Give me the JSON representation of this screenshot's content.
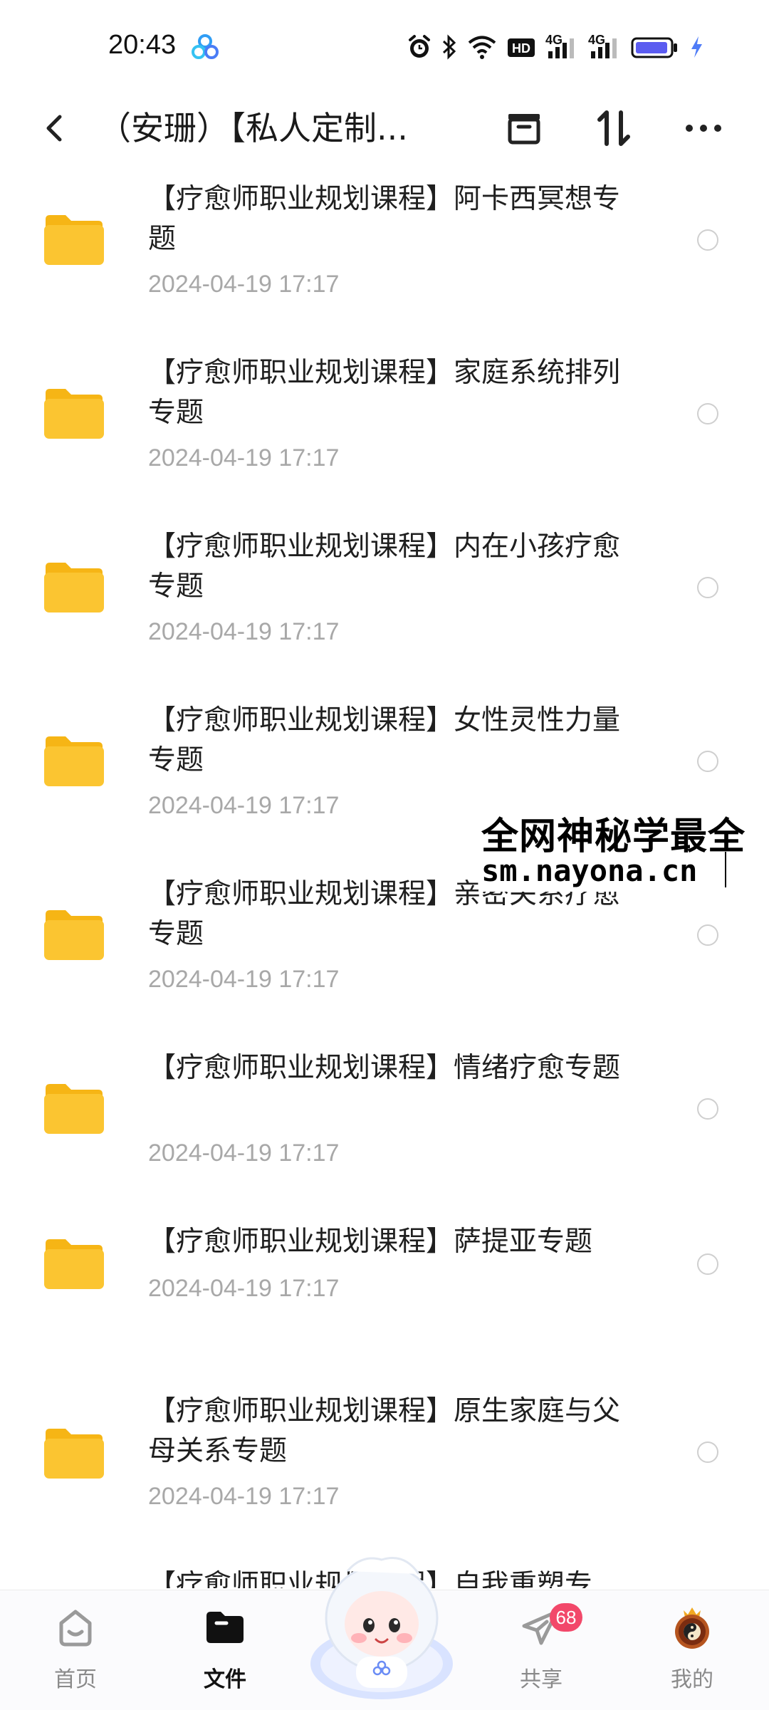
{
  "status_bar": {
    "time": "20:43",
    "network_labels": [
      "HD",
      "4G",
      "4G"
    ],
    "battery_color": "#5b5cf0",
    "charging_color": "#4f7cf7"
  },
  "header": {
    "title": "（安珊）【私人定制...",
    "icons": [
      "back-icon",
      "archive-icon",
      "sort-icon",
      "more-icon"
    ]
  },
  "files": [
    {
      "name": "【疗愈师职业规划课程】阿卡西冥想专题",
      "date": "2024-04-19  17:17"
    },
    {
      "name": "【疗愈师职业规划课程】家庭系统排列专题",
      "date": "2024-04-19  17:17"
    },
    {
      "name": "【疗愈师职业规划课程】内在小孩疗愈专题",
      "date": "2024-04-19  17:17"
    },
    {
      "name": "【疗愈师职业规划课程】女性灵性力量专题",
      "date": "2024-04-19  17:17"
    },
    {
      "name": "【疗愈师职业规划课程】亲密关系疗愈专题",
      "date": "2024-04-19  17:17"
    },
    {
      "name": "【疗愈师职业规划课程】情绪疗愈专题",
      "date": "2024-04-19  17:17"
    },
    {
      "name": "【疗愈师职业规划课程】萨提亚专题",
      "date": "2024-04-19  17:17"
    },
    {
      "name": "【疗愈师职业规划课程】原生家庭与父母关系专题",
      "date": "2024-04-19  17:17"
    },
    {
      "name": "【疗愈师职业规划课程】自我重塑专",
      "date": ""
    }
  ],
  "watermark": {
    "line1": "全网神秘学最全",
    "line2": "sm.nayona.cn"
  },
  "bottom_nav": {
    "items": [
      {
        "label": "首页",
        "icon": "home-icon"
      },
      {
        "label": "文件",
        "icon": "folder-icon",
        "active": true
      },
      {
        "label": "共享",
        "icon": "paper-plane-icon",
        "badge": "68"
      },
      {
        "label": "我的",
        "icon": "avatar-icon"
      }
    ],
    "assistant_icon": "ai-assistant-mascot"
  },
  "colors": {
    "folder": "#fbc531",
    "folder_tab": "#f6b515",
    "date_text": "#a8a8a8",
    "badge": "#f2486a",
    "active_nav": "#111111"
  }
}
